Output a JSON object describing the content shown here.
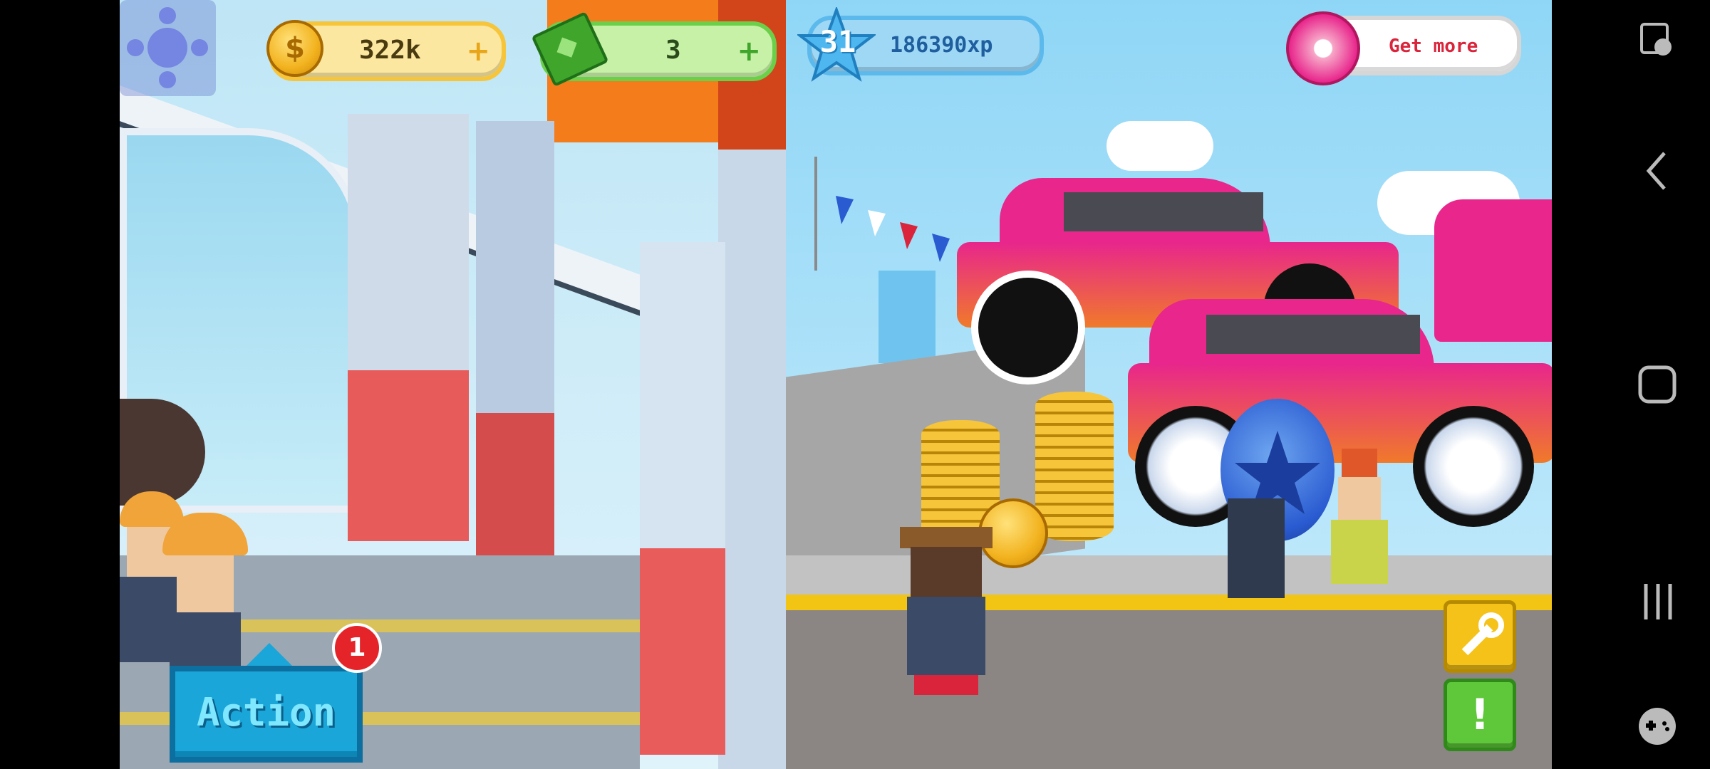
{
  "hud": {
    "coins": "322k",
    "cash": "3",
    "level": "31",
    "xp": "186390xp",
    "get_more": "Get more"
  },
  "action": {
    "label": "Action",
    "badge": "1"
  },
  "colors": {
    "coin_pill": "#fbe7a0",
    "cash_pill": "#c8f1a8",
    "xp_pill": "#9fd8f5",
    "donut_pill": "#ffffff",
    "action_btn": "#1aa6d8",
    "wrench_btn": "#f5c21a",
    "alert_btn": "#5ec83a",
    "car_body": "#e8268c"
  },
  "icons": {
    "coin": "coin-icon",
    "cash": "cash-icon",
    "xp": "xp-star-icon",
    "donut": "donut-icon",
    "wrench": "wrench-icon",
    "alert": "exclamation-icon"
  },
  "system_nav": {
    "top": "game-tools-icon",
    "back": "back-icon",
    "home": "home-icon",
    "recents": "recents-icon",
    "bottom": "game-launcher-icon"
  }
}
